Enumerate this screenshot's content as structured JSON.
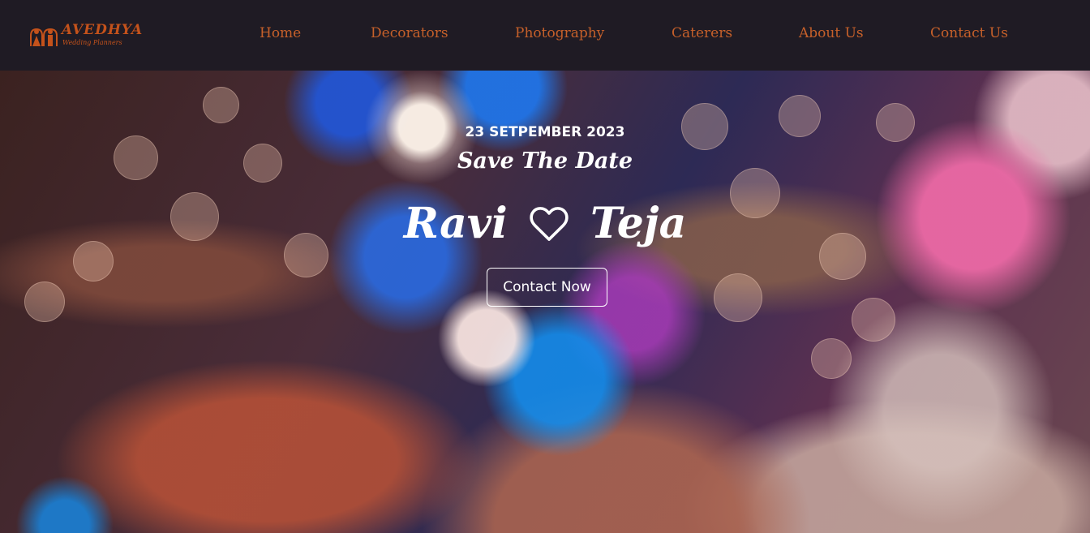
{
  "brand": {
    "name": "AVEDHYA",
    "tagline": "Wedding Planners",
    "logo_icon": "couple-icon",
    "color": "#c4521b"
  },
  "nav": {
    "items": [
      {
        "label": "Home"
      },
      {
        "label": "Decorators"
      },
      {
        "label": "Photography"
      },
      {
        "label": "Caterers"
      },
      {
        "label": "About Us"
      },
      {
        "label": "Contact Us"
      }
    ],
    "text_color": "#c6602a",
    "background": "#1f1b24"
  },
  "hero": {
    "date": "23 SETPEMBER 2023",
    "subtitle": "Save The Date",
    "name_left": "Ravi",
    "name_right": "Teja",
    "heart_icon": "heart-outline-icon",
    "cta_label": "Contact Now",
    "background_image": "wedding-hands-bokeh"
  }
}
